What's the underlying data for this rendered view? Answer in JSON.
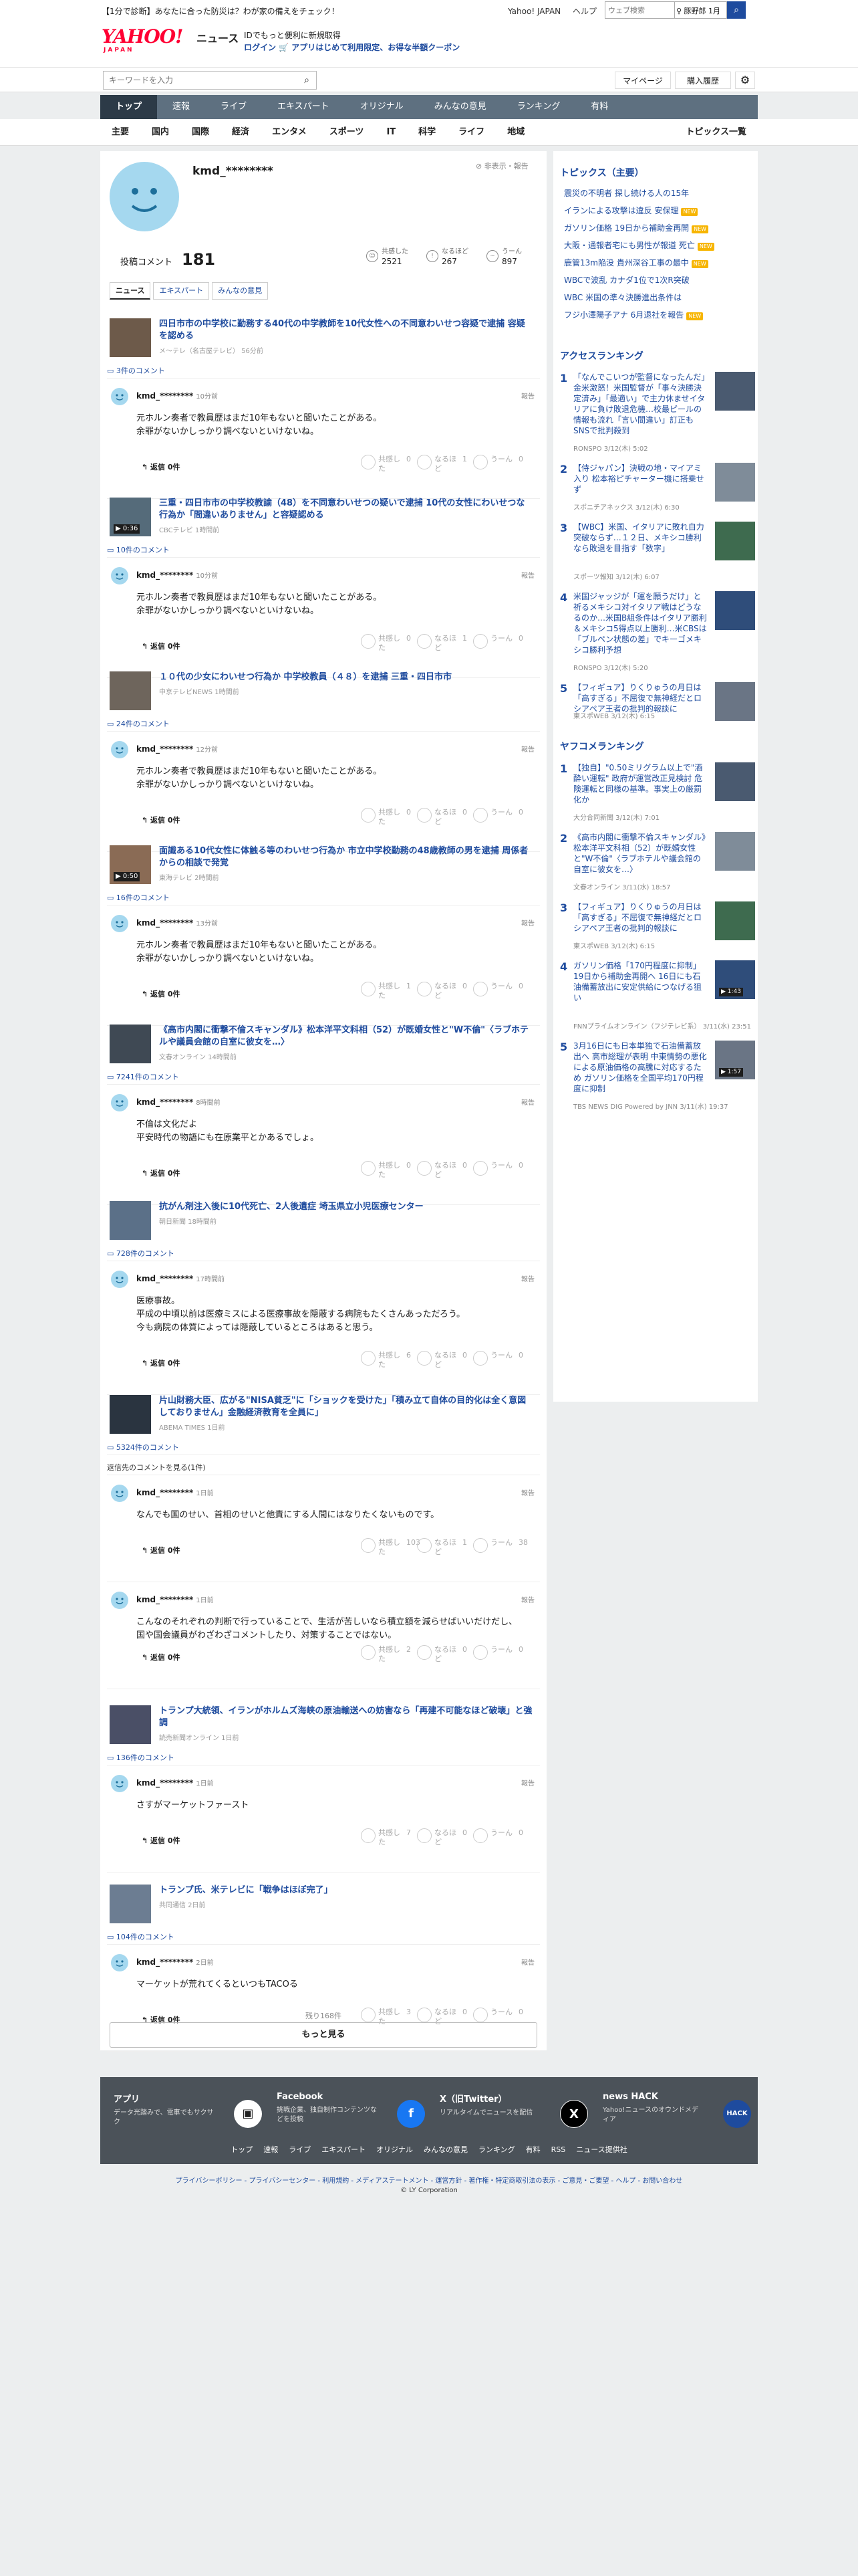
{
  "header": {
    "promo": "【1分で診断】あなたに合った防災は？わが家の備えをチェック！",
    "links": [
      "Yahoo! JAPAN",
      "ヘルプ"
    ],
    "web_search_placeholder": "ウェブ検索",
    "plan_label": "♀ 豚野郎 1月",
    "logo_text": "YAHOO!",
    "logo_sub": "JAPAN",
    "section_name": "ニュース",
    "login_line1": "IDでもっと便利に新規取得",
    "login_line2": "ログイン 🛒 アプリはじめて利用限定、お得な半額クーポン",
    "news_search_placeholder": "キーワードを入力",
    "mypage": "マイページ",
    "history": "購入履歴"
  },
  "global_nav": [
    "トップ",
    "速報",
    "ライブ",
    "エキスパート",
    "オリジナル",
    "みんなの意見",
    "ランキング",
    "有料"
  ],
  "sub_nav": [
    "主要",
    "国内",
    "国際",
    "経済",
    "エンタメ",
    "スポーツ",
    "IT",
    "科学",
    "ライフ",
    "地域"
  ],
  "sub_nav_right": "トピックス一覧",
  "profile": {
    "name": "kmd_********",
    "flag": "非表示・報告",
    "comment_label": "投稿コメント",
    "comment_count": "181",
    "reactions": [
      {
        "label": "共感した",
        "count": "2521"
      },
      {
        "label": "なるほど",
        "count": "267"
      },
      {
        "label": "うーん",
        "count": "897"
      }
    ],
    "tabs": [
      "ニュース",
      "エキスパート",
      "みんなの意見"
    ]
  },
  "entries": [
    {
      "title": "四日市市の中学校に勤務する40代の中学教師を10代女性への不同意わいせつ容疑で逮捕 容疑を認める",
      "source": "メ～テレ（名古屋テレビ） 56分前",
      "video": "",
      "comment_link": "3件のコメント",
      "comments": [
        {
          "name": "kmd_********",
          "time": "10分前",
          "report": "報告",
          "text": "元ホルン奏者で教員歴はまだ10年もないと聞いたことがある。\n余罪がないかしっかり調べないといけないね。",
          "reply": "返信 0件",
          "r": [
            "0",
            "1",
            "0"
          ]
        }
      ]
    },
    {
      "title": "三重・四日市市の中学校教諭（48）を不同意わいせつの疑いで逮捕 10代の女性にわいせつな行為か「間違いありません」と容疑認める",
      "source": "CBCテレビ 1時間前",
      "video": "▶ 0:36",
      "comment_link": "10件のコメント",
      "comments": [
        {
          "name": "kmd_********",
          "time": "10分前",
          "report": "報告",
          "text": "元ホルン奏者で教員歴はまだ10年もないと聞いたことがある。\n余罪がないかしっかり調べないといけないね。",
          "reply": "返信 0件",
          "r": [
            "0",
            "1",
            "0"
          ]
        }
      ]
    },
    {
      "title": "１０代の少女にわいせつ行為か 中学校教員（４８）を逮捕 三重・四日市市",
      "source": "中京テレビNEWS 1時間前",
      "video": "",
      "comment_link": "24件のコメント",
      "comments": [
        {
          "name": "kmd_********",
          "time": "12分前",
          "report": "報告",
          "text": "元ホルン奏者で教員歴はまだ10年もないと聞いたことがある。\n余罪がないかしっかり調べないといけないね。",
          "reply": "返信 0件",
          "r": [
            "0",
            "0",
            "0"
          ]
        }
      ]
    },
    {
      "title": "面識ある10代女性に体触る等のわいせつ行為か 市立中学校勤務の48歳教師の男を逮捕 周係者からの相談で発覚",
      "source": "東海テレビ 2時間前",
      "video": "▶ 0:50",
      "comment_link": "16件のコメント",
      "comments": [
        {
          "name": "kmd_********",
          "time": "13分前",
          "report": "報告",
          "text": "元ホルン奏者で教員歴はまだ10年もないと聞いたことがある。\n余罪がないかしっかり調べないといけないね。",
          "reply": "返信 0件",
          "r": [
            "1",
            "0",
            "0"
          ]
        }
      ]
    },
    {
      "title": "《高市内閣に衝撃不倫スキャンダル》松本洋平文科相（52）が既婚女性と\"W不倫\"〈ラブホテルや議員会館の自室に彼女を…〉",
      "source": "文春オンライン 14時間前",
      "video": "",
      "comment_link": "7241件のコメント",
      "comments": [
        {
          "name": "kmd_********",
          "time": "8時間前",
          "report": "報告",
          "text": "不倫は文化だよ\n平安時代の物語にも在原業平とかあるでしょ。",
          "reply": "返信 0件",
          "r": [
            "0",
            "0",
            "0"
          ]
        }
      ]
    },
    {
      "title": "抗がん剤注入後に10代死亡、2人後遺症 埼玉県立小児医療センター",
      "source": "朝日新聞 18時間前",
      "video": "",
      "comment_link": "728件のコメント",
      "comments": [
        {
          "name": "kmd_********",
          "time": "17時間前",
          "report": "報告",
          "text": "医療事故。\n平成の中頃以前は医療ミスによる医療事故を隠蔽する病院もたくさんあっただろう。\n今も病院の体質によっては隠蔽しているところはあると思う。",
          "reply": "返信 0件",
          "r": [
            "6",
            "0",
            "0"
          ]
        }
      ]
    },
    {
      "title": "片山財務大臣、広がる\"NISA貧乏\"に「ショックを受けた」「積み立て自体の目的化は全く意図しておりません」金融経済教育を全員に」",
      "source": "ABEMA TIMES 1日前",
      "video": "",
      "comment_link": "5324件のコメント",
      "note": "返信先のコメントを見る(1件)",
      "comments": [
        {
          "name": "kmd_********",
          "time": "1日前",
          "report": "報告",
          "text": "なんでも国のせい、首相のせいと他責にする人間にはなりたくないものです。",
          "reply": "返信 0件",
          "r": [
            "103",
            "1",
            "38"
          ]
        },
        {
          "name": "kmd_********",
          "time": "1日前",
          "report": "報告",
          "text": "こんなのそれぞれの判断で行っていることで、生活が苦しいなら積立額を減らせばいいだけだし、国や国会議員がわざわざコメントしたり、対策することではない。",
          "reply": "返信 0件",
          "r": [
            "2",
            "0",
            "0"
          ]
        }
      ]
    },
    {
      "title": "トランプ大統領、イランがホルムズ海峡の原油輸送への妨害なら「再建不可能なほど破壊」と強調",
      "source": "読売新聞オンライン 1日前",
      "video": "",
      "comment_link": "136件のコメント",
      "comments": [
        {
          "name": "kmd_********",
          "time": "1日前",
          "report": "報告",
          "text": "さすがマーケットファースト",
          "reply": "返信 0件",
          "r": [
            "7",
            "0",
            "0"
          ]
        }
      ]
    },
    {
      "title": "トランプ氏、米テレビに「戦争はほぼ完了」",
      "source": "共同通信 2日前",
      "video": "",
      "comment_link": "104件のコメント",
      "comments": [
        {
          "name": "kmd_********",
          "time": "2日前",
          "report": "報告",
          "text": "マーケットが荒れてくるといつもTACOる",
          "reply": "返信 0件",
          "r": [
            "3",
            "0",
            "0"
          ]
        }
      ]
    }
  ],
  "remaining": "残り168件",
  "more_button": "もっと見る",
  "sidebar": {
    "topics_title": "トピックス（主要）",
    "topics": [
      {
        "text": "震災の不明者 探し続ける人の15年",
        "badge": ""
      },
      {
        "text": "イランによる攻撃は違反 安保理",
        "badge": "NEW"
      },
      {
        "text": "ガソリン価格 19日から補助金再開",
        "badge": "NEW"
      },
      {
        "text": "大阪・通報者宅にも男性が報道 死亡",
        "badge": "NEW"
      },
      {
        "text": "鹿管13m陥没 貴州深谷工事の最中",
        "badge": "NEW"
      },
      {
        "text": "WBCで波乱 カナダ1位で1次R突破",
        "badge": ""
      },
      {
        "text": "WBC 米国の準々決勝進出条件は",
        "badge": ""
      },
      {
        "text": "フジ小澤陽子アナ 6月退社を報告",
        "badge": "NEW"
      }
    ],
    "access_title": "アクセスランキング",
    "access": [
      {
        "n": "1",
        "title": "「なんでこいつが監督になったんだ」金米激怒！米国監督が「事々決勝決定済み」「最適い」で主力休ませイタリアに負け敗退危機…校最ピールの情報も流れ「言い間違い」訂正もSNSで批判殺到",
        "src": "RONSPO 3/12(木) 5:02",
        "video": ""
      },
      {
        "n": "2",
        "title": "【侍ジャパン】決戦の地・マイアミ入り 松本裕ピチャーター機に搭乗せず",
        "src": "スポニチアネックス 3/12(木) 6:30",
        "video": ""
      },
      {
        "n": "3",
        "title": "【WBC】米国、イタリアに敗れ自力突破ならず…１２日、メキシコ勝利なら敗退を目指す「数字」",
        "src": "スポーツ報知 3/12(木) 6:07",
        "video": ""
      },
      {
        "n": "4",
        "title": "米国ジャッジが「運を願うだけ」と祈るメキシコ対イタリア戦はどうなるのか…米国B組条件はイタリア勝利＆メキシコ5得点以上勝利…米CBSは「ブルペン状態の差」でキーゴメキシコ勝利予想",
        "src": "RONSPO 3/12(木) 5:20",
        "video": ""
      },
      {
        "n": "5",
        "title": "【フィギュア】りくりゅうの月日は「高すぎる」不屈復で無神経だとロシアペア王者の批判的報談に",
        "src": "東スポWEB 3/12(木) 6:15",
        "video": ""
      }
    ],
    "yahoo_title": "ヤフコメランキング",
    "yahoo": [
      {
        "n": "1",
        "title": "【独自】\"0.50ミリグラム以上で\"酒酔い運転\" 政府が運営改正見検討 危険運転と同様の基準。事実上の厳罰化か",
        "src": "大分合同新聞 3/12(木) 7:01",
        "video": ""
      },
      {
        "n": "2",
        "title": "《高市内閣に衝撃不倫スキャンダル》松本洋平文科相（52）が既婚女性と\"W不倫\"〈ラブホテルや議会館の自室に彼女を…〉",
        "src": "文春オンライン 3/11(水) 18:57",
        "video": ""
      },
      {
        "n": "3",
        "title": "【フィギュア】りくりゅうの月日は「高すぎる」不屈復で無神経だとロシアペア王者の批判的報談に",
        "src": "東スポWEB 3/12(木) 6:15",
        "video": ""
      },
      {
        "n": "4",
        "title": "ガソリン価格「170円程度に抑制」19日から補助金再開へ 16日にも石油備蓄放出に安定供給につなげる狙い",
        "src": "FNNプライムオンライン（フジテレビ系） 3/11(水) 23:51",
        "video": "▶ 1:43"
      },
      {
        "n": "5",
        "title": "3月16日にも日本単独で石油備蓄放出へ 高市総理が表明 中東情勢の悪化による原油価格の高騰に対応するため ガソリン価格を全国平均170円程度に抑制",
        "src": "TBS NEWS DIG Powered by JNN 3/11(水) 19:37",
        "video": "▶ 1:57"
      }
    ]
  },
  "footer": {
    "boxes": [
      {
        "title": "アプリ",
        "desc": "データ光踏みで、電車でもサクサク",
        "icon": "▣"
      },
      {
        "title": "Facebook",
        "desc": "挑戦企業、独自制作コンテンツなどを投稿",
        "icon": "f"
      },
      {
        "title": "X（旧Twitter）",
        "desc": "リアルタイムでニュースを配信",
        "icon": "X"
      },
      {
        "title": "news HACK",
        "desc": "Yahoo!ニュースのオウンドメディア",
        "icon": "HACK"
      }
    ],
    "links": [
      "トップ",
      "速報",
      "ライブ",
      "エキスパート",
      "オリジナル",
      "みんなの意見",
      "ランキング",
      "有料",
      "RSS",
      "ニュース提供社"
    ],
    "legal": "プライバシーポリシー - プライバシーセンター - 利用規約 - メディアステートメント - 運営方針 - 著作権・特定商取引法の表示 - ご意見・ご要望 - ヘルプ - お問い合わせ",
    "copyright": "© LY Corporation"
  },
  "colors": {
    "link": "#1e4b9e",
    "nav": "#5e7080",
    "accent": "#ff0033",
    "footer": "#4b5259"
  }
}
